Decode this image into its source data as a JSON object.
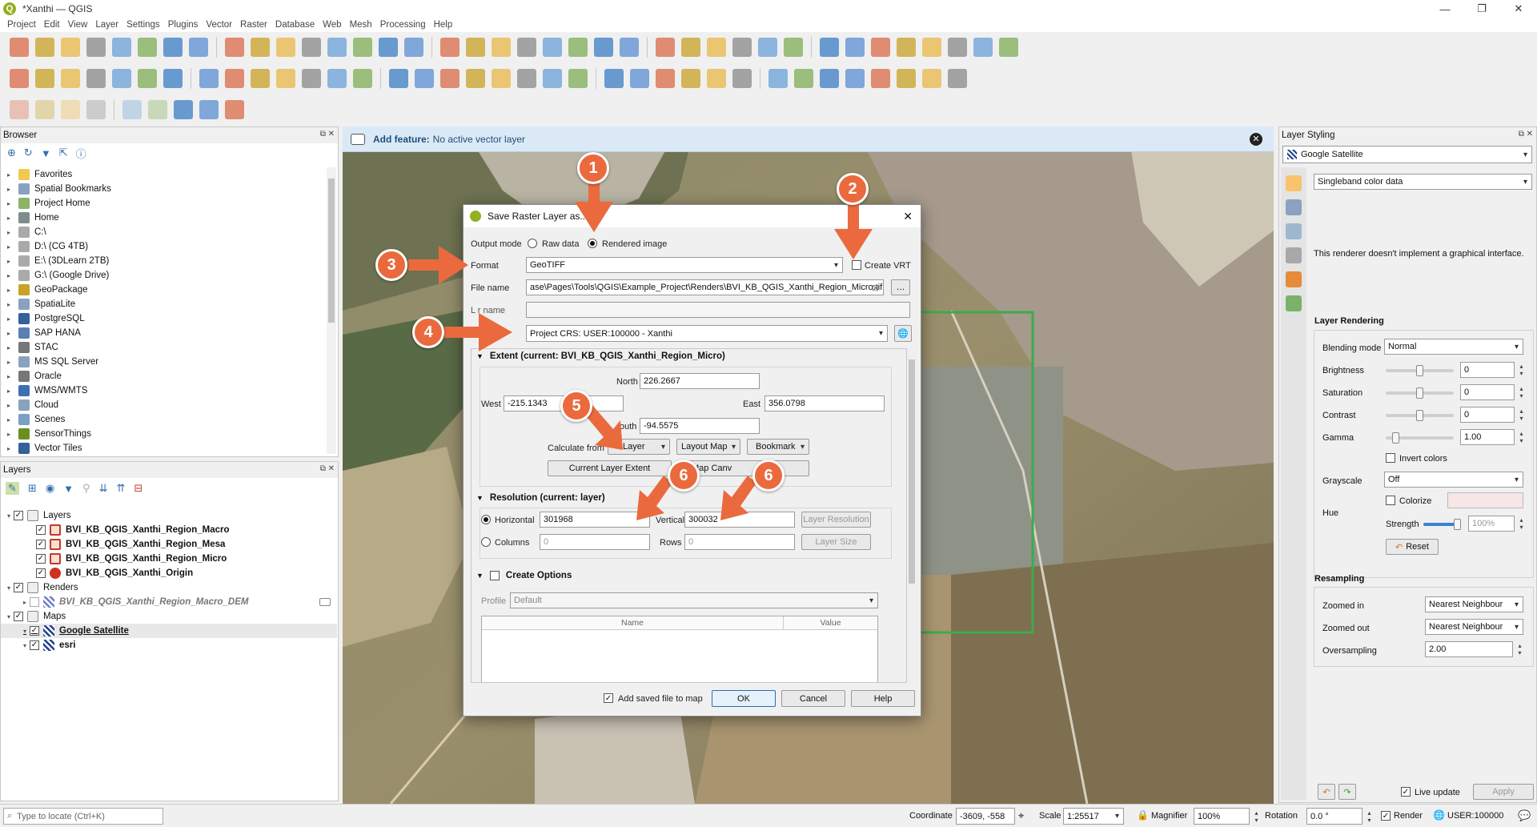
{
  "window": {
    "title": "*Xanthi — QGIS"
  },
  "menu": [
    "Project",
    "Edit",
    "View",
    "Layer",
    "Settings",
    "Plugins",
    "Vector",
    "Raster",
    "Database",
    "Web",
    "Mesh",
    "Processing",
    "Help"
  ],
  "browser": {
    "title": "Browser",
    "items": [
      "Favorites",
      "Spatial Bookmarks",
      "Project Home",
      "Home",
      "C:\\",
      "D:\\ (CG 4TB)",
      "E:\\ (3DLearn 2TB)",
      "G:\\ (Google Drive)",
      "GeoPackage",
      "SpatiaLite",
      "PostgreSQL",
      "SAP HANA",
      "STAC",
      "MS SQL Server",
      "Oracle",
      "WMS/WMTS",
      "Cloud",
      "Scenes",
      "SensorThings",
      "Vector Tiles"
    ]
  },
  "layers": {
    "title": "Layers",
    "group_layers": "Layers",
    "items_layers": [
      "BVI_KB_QGIS_Xanthi_Region_Macro",
      "BVI_KB_QGIS_Xanthi_Region_Mesa",
      "BVI_KB_QGIS_Xanthi_Region_Micro",
      "BVI_KB_QGIS_Xanthi_Origin"
    ],
    "group_renders": "Renders",
    "renders_item": "BVI_KB_QGIS_Xanthi_Region_Macro_DEM",
    "group_maps": "Maps",
    "maps_items": [
      "Google Satellite",
      "esri"
    ]
  },
  "messagebar": {
    "title": "Add feature:",
    "text": "No active vector layer"
  },
  "dialog": {
    "title": "Save Raster Layer as...",
    "output_mode_label": "Output mode",
    "raw_data": "Raw data",
    "rendered_image": "Rendered image",
    "format_label": "Format",
    "format_value": "GeoTIFF",
    "create_vrt": "Create VRT",
    "file_name_label": "File name",
    "file_name_value": "ase\\Pages\\Tools\\QGIS\\Example_Project\\Renders\\BVI_KB_QGIS_Xanthi_Region_Micro.tif",
    "layer_name_label": "L    r name",
    "crs_value": "Project CRS: USER:100000 - Xanthi",
    "extent_title": "Extent (current: BVI_KB_QGIS_Xanthi_Region_Micro)",
    "north_label": "North",
    "north_value": "226.2667",
    "west_label": "West",
    "west_value": "-215.1343",
    "east_label": "East",
    "east_value": "356.0798",
    "south_label": "outh",
    "south_value": "-94.5575",
    "calc_from": "Calculate from",
    "calc_layer": "Layer",
    "calc_layout": "Layout Map",
    "calc_bookmark": "Bookmark",
    "current_layer_extent": "Current Layer Extent",
    "map_canvas_extent": "Map Canv",
    "map_canvas_extent_tail": "nt",
    "resolution_title": "Resolution (current: layer)",
    "horizontal_label": "Horizontal",
    "horizontal_value": "301968",
    "vertical_label": "Vertical",
    "vertical_value": "300032",
    "layer_resolution": "Layer Resolution",
    "columns_label": "Columns",
    "columns_value": "0",
    "rows_label": "Rows",
    "rows_value": "0",
    "layer_size": "Layer Size",
    "create_options": "Create Options",
    "profile_label": "Profile",
    "profile_value": "Default",
    "col_name": "Name",
    "col_value": "Value",
    "add_saved": "Add saved file to map",
    "ok": "OK",
    "cancel": "Cancel",
    "help": "Help"
  },
  "annotations": [
    "1",
    "2",
    "3",
    "4",
    "5",
    "6",
    "6"
  ],
  "styling": {
    "title": "Layer Styling",
    "layer": "Google Satellite",
    "renderer": "Singleband color data",
    "renderer_msg": "This renderer doesn't implement a graphical interface.",
    "layer_rendering": "Layer Rendering",
    "blending_label": "Blending mode",
    "blending_value": "Normal",
    "brightness_label": "Brightness",
    "brightness_value": "0",
    "saturation_label": "Saturation",
    "saturation_value": "0",
    "contrast_label": "Contrast",
    "contrast_value": "0",
    "gamma_label": "Gamma",
    "gamma_value": "1.00",
    "invert": "Invert colors",
    "grayscale_label": "Grayscale",
    "grayscale_value": "Off",
    "hue_label": "Hue",
    "colorize": "Colorize",
    "strength_label": "Strength",
    "strength_value": "100%",
    "reset": "Reset",
    "resampling": "Resampling",
    "zoomed_in_label": "Zoomed in",
    "zoomed_in_value": "Nearest Neighbour",
    "zoomed_out_label": "Zoomed out",
    "zoomed_out_value": "Nearest Neighbour",
    "oversampling_label": "Oversampling",
    "oversampling_value": "2.00",
    "live_update": "Live update",
    "apply": "Apply"
  },
  "status": {
    "locate_placeholder": "Type to locate (Ctrl+K)",
    "coordinate_label": "Coordinate",
    "coordinate_value": "-3609, -558",
    "scale_label": "Scale",
    "scale_value": "1:25517",
    "magnifier_label": "Magnifier",
    "magnifier_value": "100%",
    "rotation_label": "Rotation",
    "rotation_value": "0.0 °",
    "render": "Render",
    "crs": "USER:100000"
  },
  "colors": {
    "accent_orange": "#ea6a3d",
    "message_bar": "#dbe9f7",
    "qgis_green": "#93b023"
  }
}
